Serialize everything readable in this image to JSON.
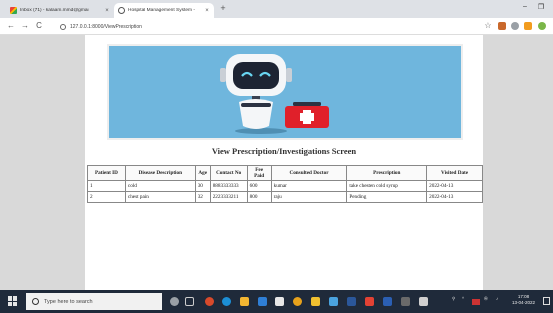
{
  "browser": {
    "tabs": [
      {
        "label": "Inbox (71) - kalaam.mmd@gmai",
        "close": "×"
      },
      {
        "label": "Hospital Management System - ",
        "close": "×"
      }
    ],
    "new_tab": "+",
    "minimize": "–",
    "restore": "❐",
    "back": "←",
    "forward": "→",
    "reload": "C",
    "url": "127.0.0.1:8000/ViewPrescription",
    "star": "☆"
  },
  "page": {
    "title": "View Prescription/Investigations Screen",
    "table": {
      "headers": [
        "Patient ID",
        "Disease Description",
        "Age",
        "Contact No",
        "Fee Paid",
        "Consulted Doctor",
        "Prescription",
        "Visited Date"
      ],
      "rows": [
        [
          "1",
          "cold",
          "30",
          "8883333333",
          "600",
          "kumar",
          "take chesten cold syrup",
          "2022-04-13"
        ],
        [
          "2",
          "chest pain",
          "32",
          "2223333211",
          "800",
          "raju",
          "Pending",
          "2022-04-13"
        ]
      ]
    }
  },
  "taskbar": {
    "search_placeholder": "Type here to search",
    "time": "17:08",
    "date": "13-04-2022"
  },
  "colors": {
    "banner_bg": "#6fb6dd",
    "taskbar_bg": "#1f2a3a",
    "kit_red": "#e0202a"
  }
}
